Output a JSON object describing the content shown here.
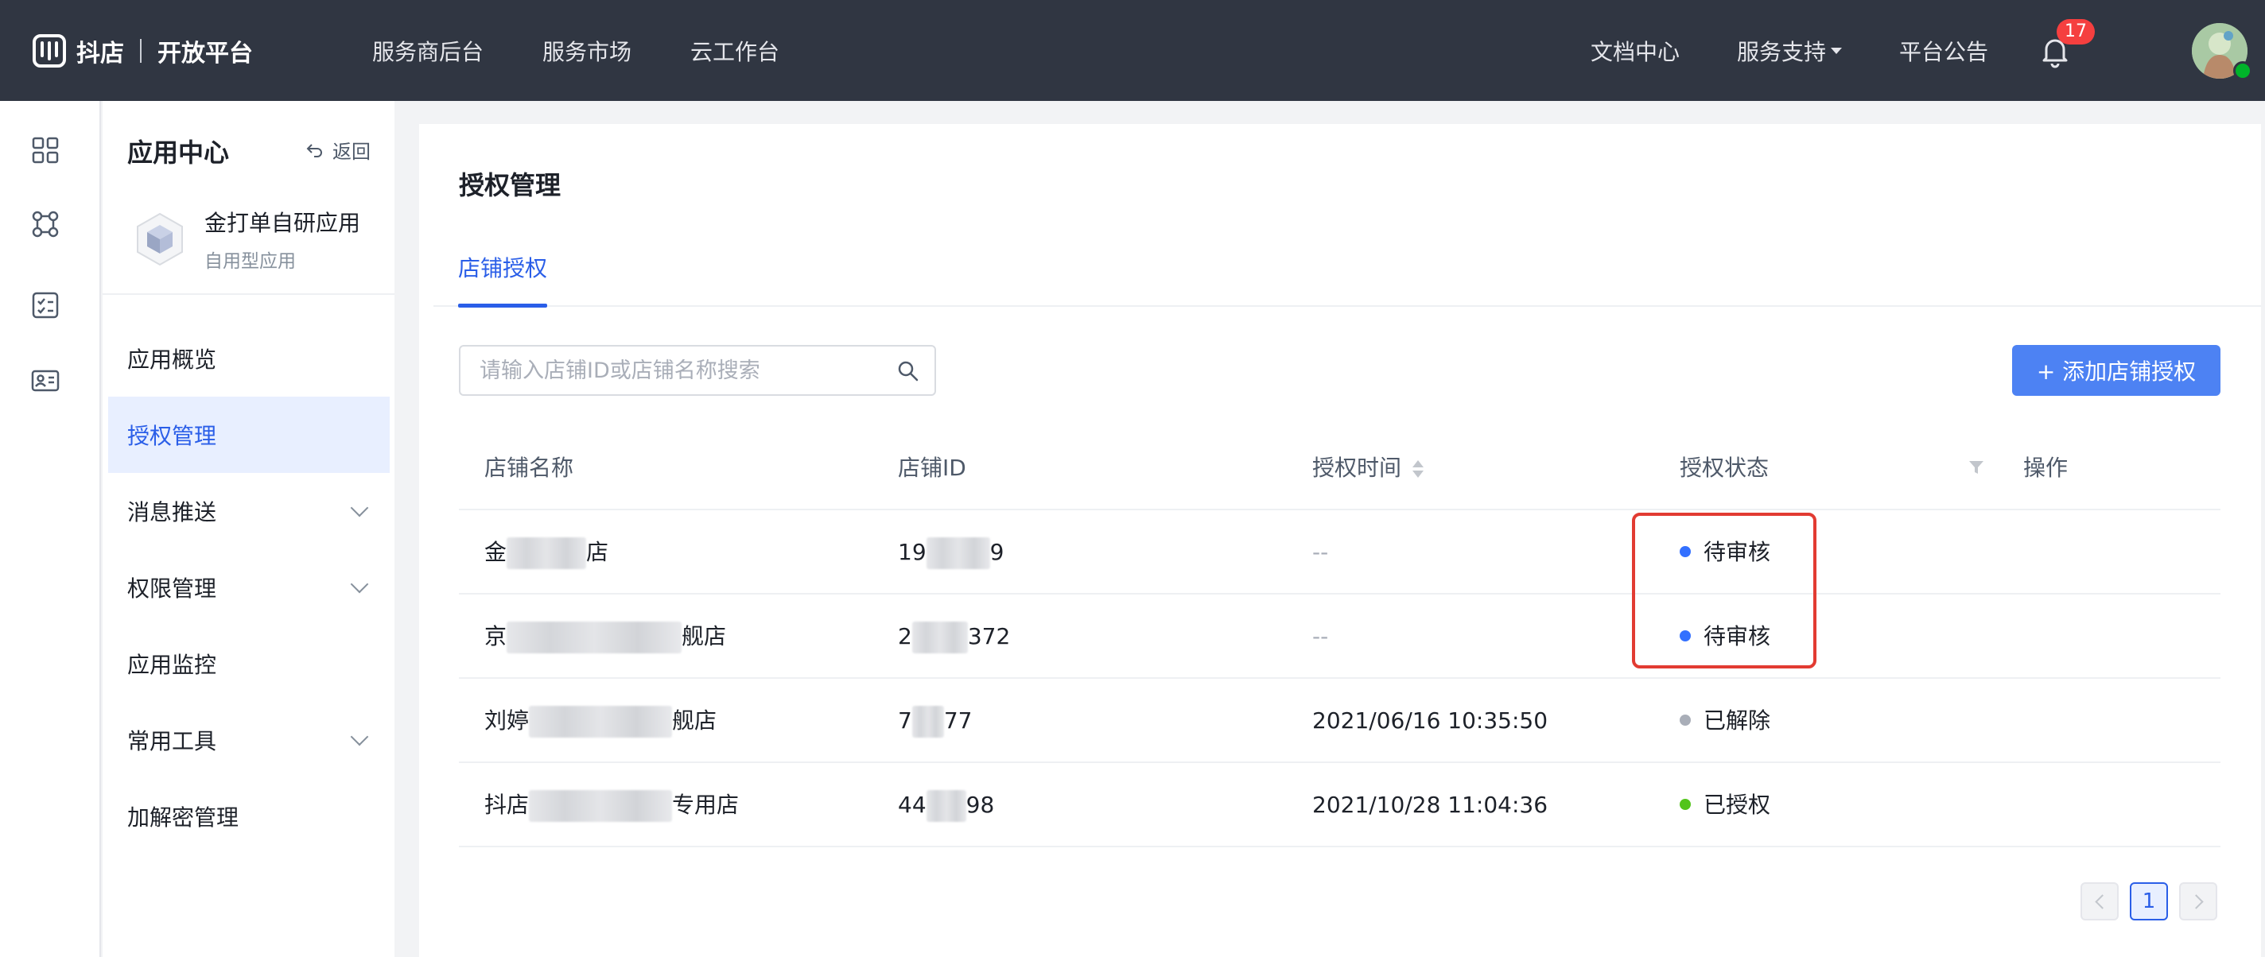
{
  "header": {
    "brand": "抖店",
    "subtitle": "开放平台",
    "nav": [
      "服务商后台",
      "服务市场",
      "云工作台"
    ],
    "right": {
      "docs": "文档中心",
      "support": "服务支持",
      "announcements": "平台公告",
      "notification_count": "17"
    }
  },
  "sidebar": {
    "title": "应用中心",
    "back_label": "返回",
    "app": {
      "name": "金打单自研应用",
      "type": "自用型应用"
    },
    "menu": [
      {
        "label": "应用概览",
        "active": false,
        "expandable": false
      },
      {
        "label": "授权管理",
        "active": true,
        "expandable": false
      },
      {
        "label": "消息推送",
        "active": false,
        "expandable": true
      },
      {
        "label": "权限管理",
        "active": false,
        "expandable": true
      },
      {
        "label": "应用监控",
        "active": false,
        "expandable": false
      },
      {
        "label": "常用工具",
        "active": false,
        "expandable": true
      },
      {
        "label": "加解密管理",
        "active": false,
        "expandable": false
      }
    ]
  },
  "main": {
    "title": "授权管理",
    "tabs": [
      {
        "label": "店铺授权",
        "active": true
      }
    ],
    "search": {
      "placeholder": "请输入店铺ID或店铺名称搜索",
      "value": ""
    },
    "add_button": "+ 添加店铺授权",
    "table": {
      "columns": [
        "店铺名称",
        "店铺ID",
        "授权时间",
        "授权状态",
        "操作"
      ],
      "rows": [
        {
          "name_start": "金",
          "name_end": "店",
          "id_start": "19",
          "id_end": "9",
          "time": "--",
          "status": "待审核",
          "status_color": "#3370ff"
        },
        {
          "name_start": "京",
          "name_end": "舰店",
          "id_start": "2",
          "id_end": "372",
          "time": "--",
          "status": "待审核",
          "status_color": "#3370ff"
        },
        {
          "name_start": "刘婷",
          "name_end": "舰店",
          "id_start": "7",
          "id_end": "77",
          "time": "2021/06/16 10:35:50",
          "status": "已解除",
          "status_color": "#a9aeb8"
        },
        {
          "name_start": "抖店",
          "name_end": "专用店",
          "id_start": "44",
          "id_end": "98",
          "time": "2021/10/28 11:04:36",
          "status": "已授权",
          "status_color": "#52c41a"
        }
      ]
    },
    "pagination": {
      "current_page": "1"
    }
  },
  "colors": {
    "topbar": "#303642",
    "accent": "#2a5ee8",
    "button": "#4d82f3",
    "highlight_box": "#e23b32"
  }
}
